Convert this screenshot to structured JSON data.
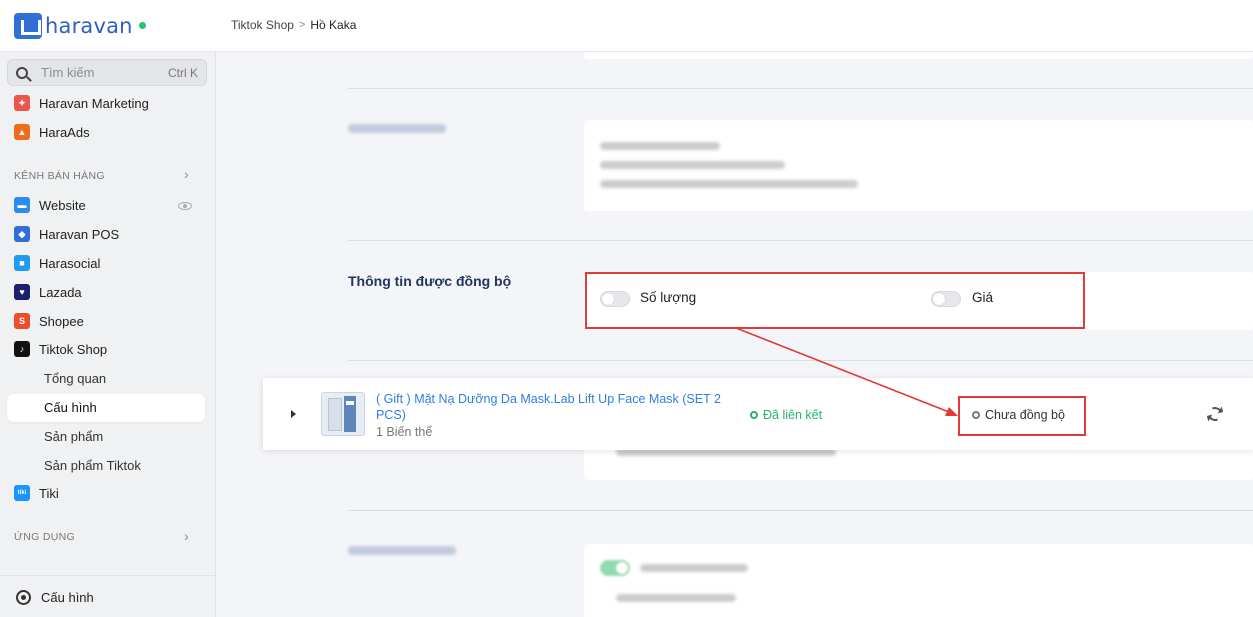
{
  "app": {
    "logo_text": "haravan",
    "online_color": "#27c26c"
  },
  "breadcrumb": {
    "parent": "Tiktok Shop",
    "separator": ">",
    "current": "Hồ Kaka"
  },
  "search": {
    "placeholder": "Tìm kiếm",
    "shortcut": "Ctrl K"
  },
  "sidebar": {
    "top_items": [
      {
        "label": "Haravan Marketing",
        "icon": "marketing-icon",
        "color": "#e9574f"
      },
      {
        "label": "HaraAds",
        "icon": "haraads-icon",
        "color": "#f26b1d"
      }
    ],
    "sales_section": "KÊNH BÁN HÀNG",
    "channels": [
      {
        "label": "Website",
        "icon": "website-icon",
        "color": "#2a8cf0"
      },
      {
        "label": "Haravan POS",
        "icon": "pos-icon",
        "color": "#2f6fd6"
      },
      {
        "label": "Harasocial",
        "icon": "harasocial-icon",
        "color": "#1f9bf0"
      },
      {
        "label": "Lazada",
        "icon": "lazada-icon",
        "color": "#1c1f6b"
      },
      {
        "label": "Shopee",
        "icon": "shopee-icon",
        "color": "#ee4d2d"
      },
      {
        "label": "Tiktok Shop",
        "icon": "tiktok-icon",
        "color": "#111111"
      }
    ],
    "tiktok_sub": [
      "Tổng quan",
      "Cấu hình",
      "Sản phẩm",
      "Sản phẩm Tiktok"
    ],
    "active_sub": "Cấu hình",
    "tiki": {
      "label": "Tiki",
      "icon": "tiki-icon",
      "color": "#1a94ff",
      "glyph": "tiki"
    },
    "apps_section": "ỨNG DỤNG",
    "footer": {
      "label": "Cấu hình",
      "icon": "gear-icon"
    }
  },
  "sync_section": {
    "title": "Thông tin được đồng bộ",
    "options": [
      {
        "label": "Số lượng",
        "enabled": false
      },
      {
        "label": "Giá",
        "enabled": false
      }
    ]
  },
  "product": {
    "name": "( Gift ) Mặt Nạ Dưỡng Da Mask.Lab Lift Up Face Mask (SET 2 PCS)",
    "variants": "1 Biến thể",
    "link_status": "Đã liên kết",
    "sync_status": "Chưa đồng bộ"
  },
  "colors": {
    "accent": "#2f7fe0",
    "success": "#27b36a",
    "highlight": "#e03a3a",
    "heading": "#25345e"
  }
}
